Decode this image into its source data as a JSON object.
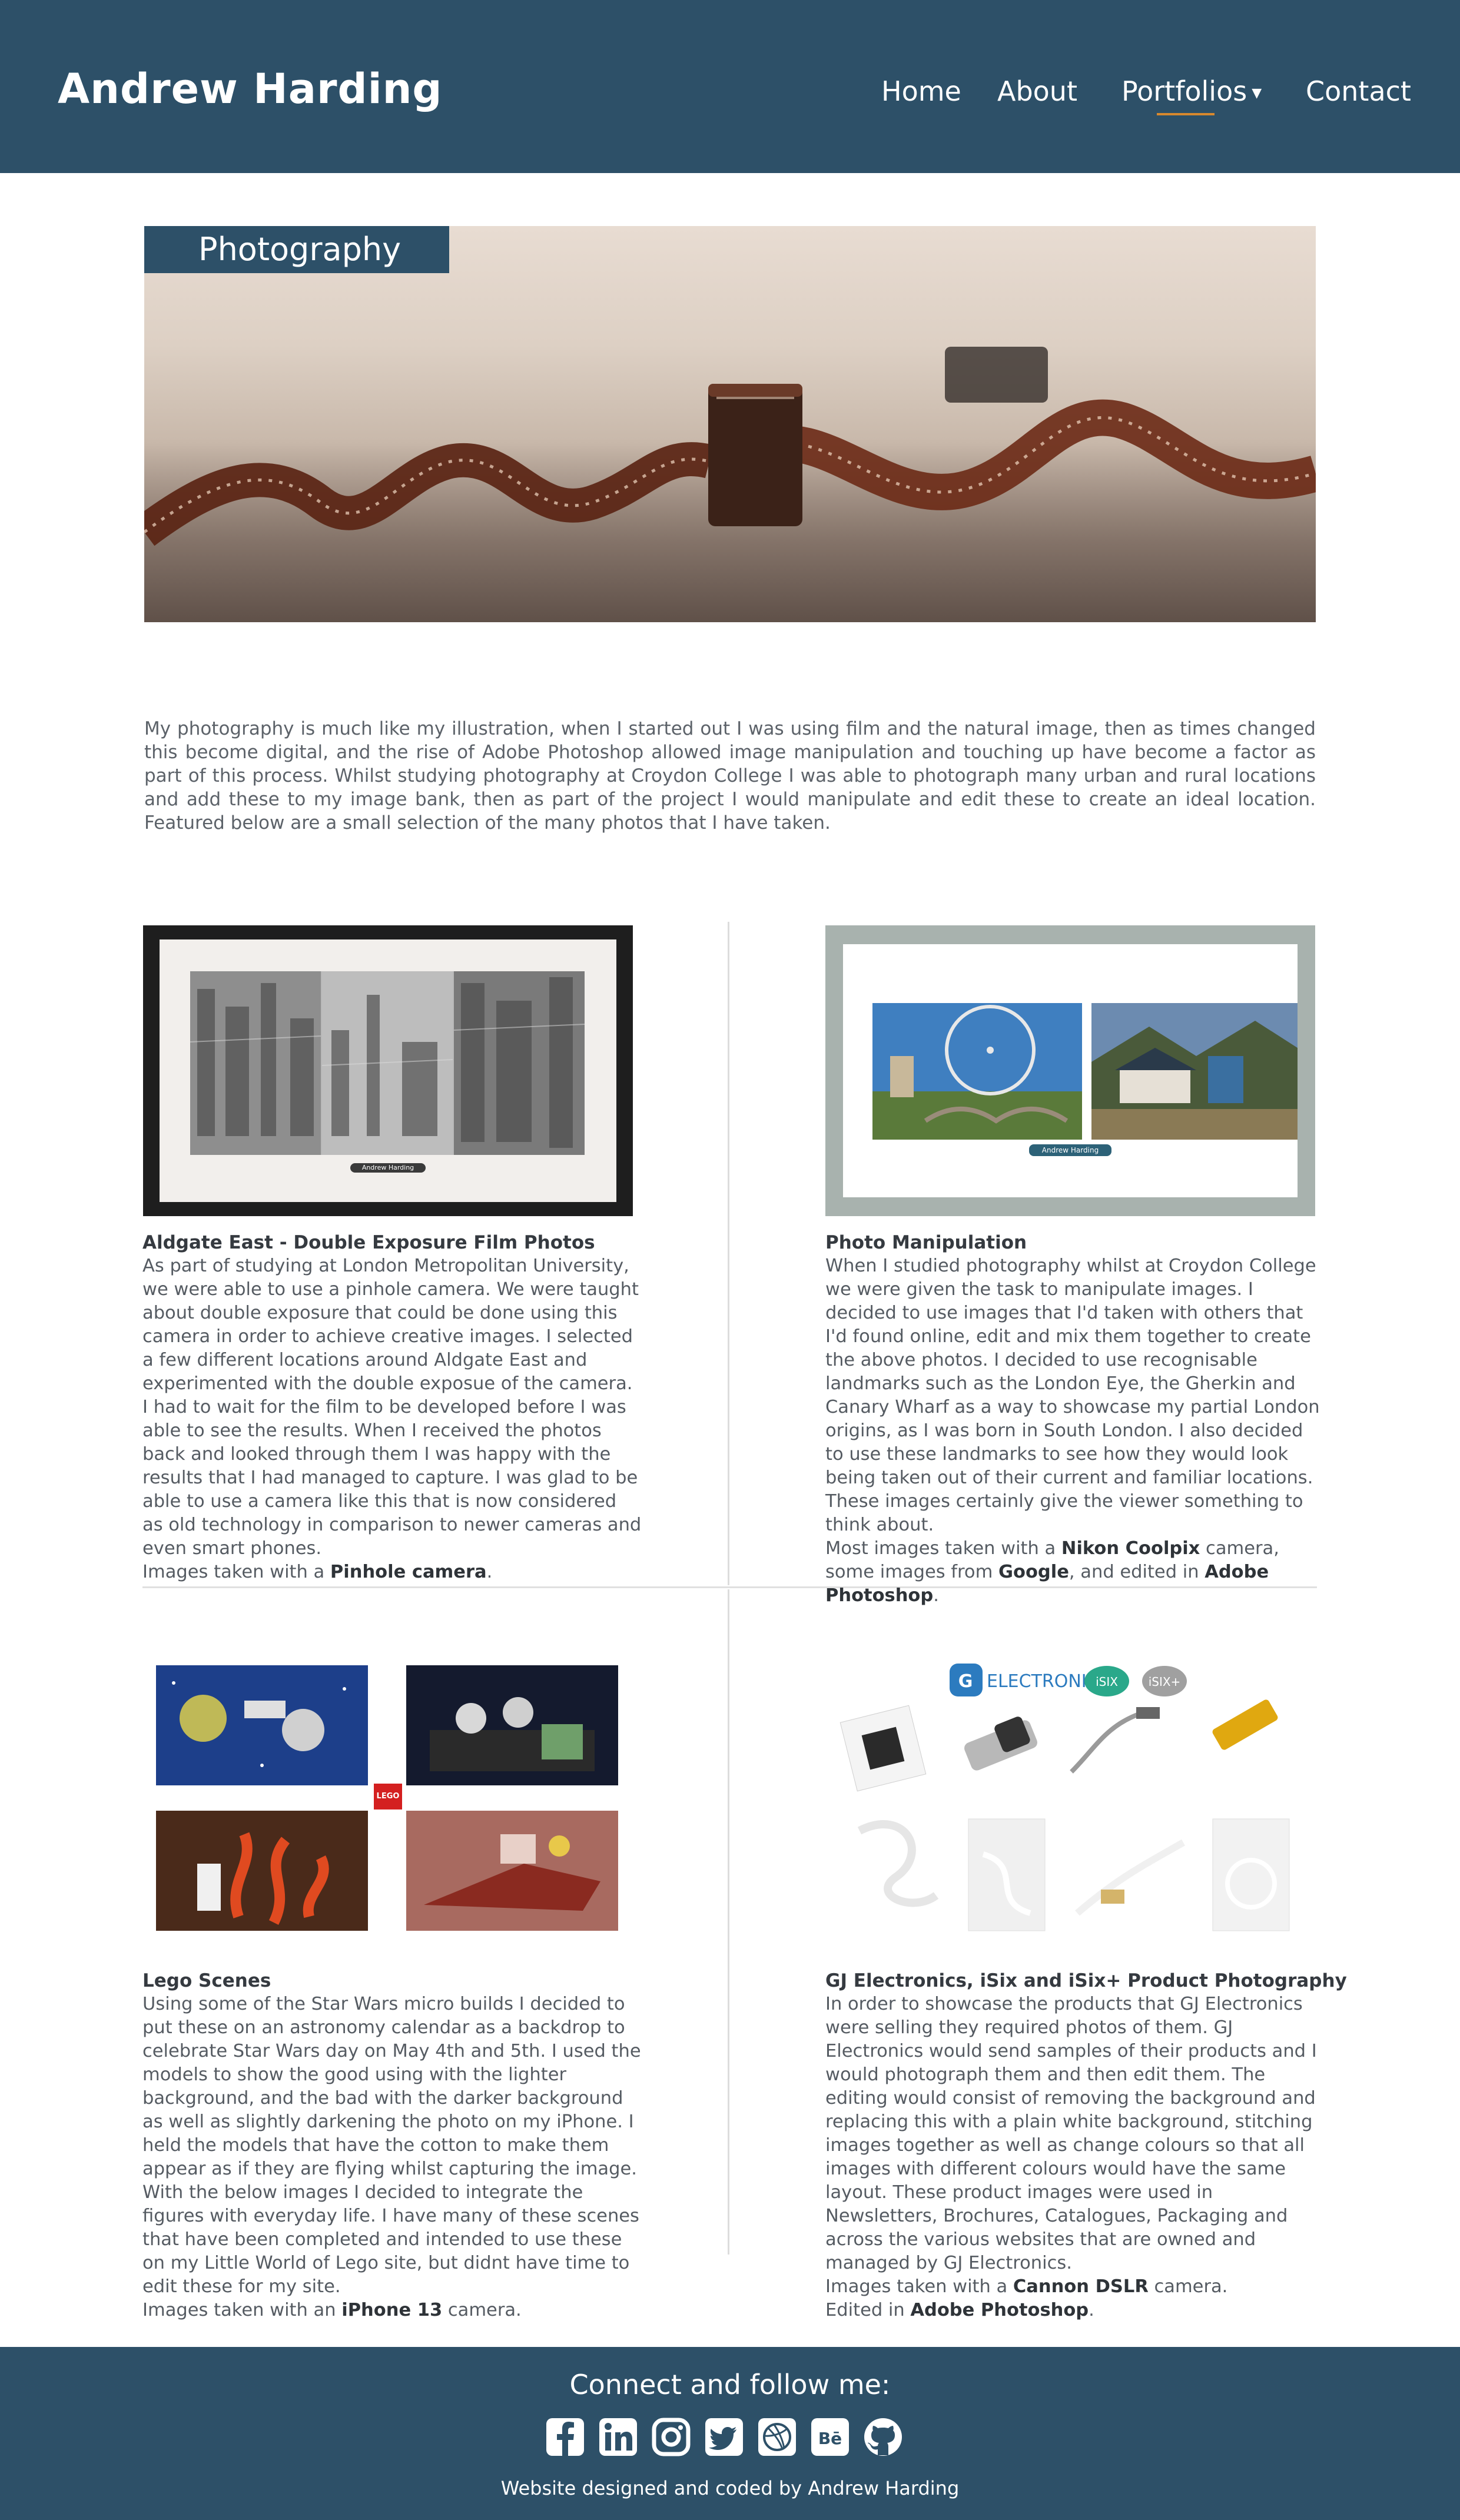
{
  "header": {
    "site_title": "Andrew Harding",
    "nav": {
      "home": "Home",
      "about": "About",
      "portfolios": "Portfolios",
      "contact": "Contact"
    },
    "active": "Portfolios"
  },
  "banner": {
    "label": "Photography"
  },
  "intro": "My photography is much like my illustration, when I started out I was using film and the natural image, then as times changed this become digital, and the rise of Adobe Photoshop allowed image manipulation and touching up have become a factor as part of this process. Whilst studying photography at Croydon College I was able to photograph many urban and rural locations and add these to my image bank, then as part of the project I would manipulate and edit these to create an ideal location. Featured below are a small selection of the many photos that I have taken.",
  "cards": [
    {
      "title": "Aldgate East - Double Exposure Film Photos",
      "frame_tag": "Andrew Harding",
      "text": "As part of studying at London Metropolitan University, we were able to use a pinhole camera. We were taught about double exposure that could be done using this camera in order to achieve creative images. I selected a few different locations around Aldgate East and experimented with the double exposue of the camera. I had to wait for the film to be developed before I was able to see the results. When I received the photos back and looked through them I was happy with the results that I had managed to capture. I was glad to be able to use a camera like this that is now considered as old technology in comparison to newer cameras and even smart phones.",
      "credit_prefix": "Images taken with a ",
      "credit_bold": "Pinhole camera",
      "credit_suffix": "."
    },
    {
      "title": "Photo Manipulation",
      "frame_tag": "Andrew Harding",
      "text": "When I studied photography whilst at Croydon College we were given the task to manipulate images. I decided to use images that I'd taken with others that I'd found online, edit and mix them together to create the above photos. I decided to use recognisable landmarks such as the London Eye, the Gherkin and Canary Wharf as a way to showcase my partial London origins, as I was born in South London. I also decided to use these landmarks to see how they would look being taken out of their current and familiar locations. These images certainly give the viewer something to think about.",
      "credit_a": "Most images taken with a ",
      "credit_b": "Nikon Coolpix",
      "credit_c": " camera, some images from ",
      "credit_d": "Google",
      "credit_e": ", and edited in ",
      "credit_f": "Adobe Photoshop",
      "credit_g": "."
    },
    {
      "title": "Lego Scenes",
      "logo": "LEGO",
      "text": "Using some of the Star Wars micro builds I decided to put these on an astronomy calendar as a backdrop to celebrate Star Wars day on May 4th and 5th. I used the models to show the good using with the lighter background, and the bad with the darker background as well as slightly darkening the photo on my iPhone. I held the models that have the cotton to make them appear as if they are flying whilst capturing the image. With the below images I decided to integrate the figures with everyday life. I have many of these scenes that have been completed and intended to use these on my Little World of Lego site, but didnt have time to edit these for my site.",
      "credit_prefix": "Images taken with an ",
      "credit_bold": "iPhone 13",
      "credit_suffix": " camera."
    },
    {
      "title": "GJ Electronics, iSix and iSix+ Product Photography",
      "logos": [
        "ELECTRONICS",
        "iSIX",
        "iSIX+"
      ],
      "text": "In order to showcase the products that GJ Electronics were selling they required photos of them. GJ Electronics would send samples of their products and I would photograph them and then edit them. The editing would consist of removing the background and replacing this with a plain white background, stitching images together as well as change colours so that all images with different colours would have the same layout. These product images were used in Newsletters, Brochures, Catalogues, Packaging and across the various websites that are owned and managed by GJ Electronics.",
      "credit1_prefix": "Images taken with a ",
      "credit1_bold": "Cannon DSLR",
      "credit1_suffix": " camera.",
      "credit2_prefix": "Edited in ",
      "credit2_bold": "Adobe Photoshop",
      "credit2_suffix": "."
    }
  ],
  "footer": {
    "heading": "Connect and follow me:",
    "icons": [
      "facebook-icon",
      "linkedin-icon",
      "instagram-icon",
      "twitter-icon",
      "dribbble-icon",
      "behance-icon",
      "github-icon"
    ],
    "behance_text": "Bē",
    "credit": "Website designed and coded by Andrew Harding"
  },
  "colors": {
    "brand": "#2d5068",
    "accent": "#d8892e"
  }
}
